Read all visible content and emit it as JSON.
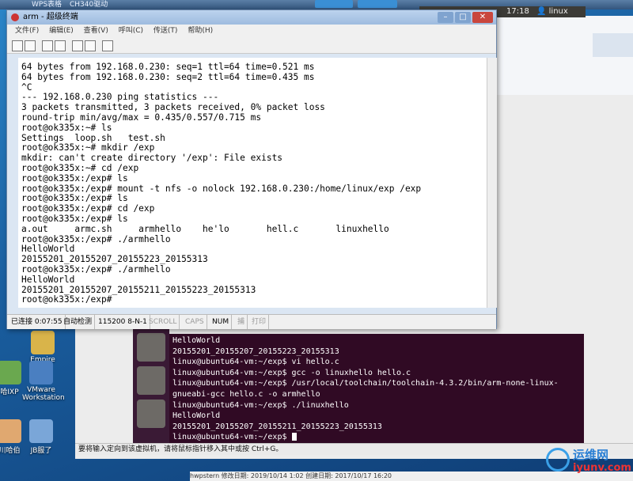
{
  "taskbar_top": {
    "items": [
      "WPS表格",
      "CH340驱动"
    ]
  },
  "desktop_icons": [
    {
      "label": "Empire",
      "icon": "folder-icon"
    },
    {
      "label": "哈IXP",
      "icon": "app-icon"
    },
    {
      "label": "VMware Workstation",
      "icon": "vmware-icon"
    },
    {
      "label": "川哈伯",
      "icon": "user-icon"
    },
    {
      "label": "JB服了",
      "icon": "app-icon"
    }
  ],
  "crt_window": {
    "title": "arm - 超级终端",
    "menu": [
      "文件(F)",
      "编辑(E)",
      "查看(V)",
      "呼叫(C)",
      "传送(T)",
      "帮助(H)"
    ],
    "terminal_lines": [
      "64 bytes from 192.168.0.230: seq=1 ttl=64 time=0.521 ms",
      "64 bytes from 192.168.0.230: seq=2 ttl=64 time=0.435 ms",
      "^C",
      "--- 192.168.0.230 ping statistics ---",
      "3 packets transmitted, 3 packets received, 0% packet loss",
      "round-trip min/avg/max = 0.435/0.557/0.715 ms",
      "root@ok335x:~# ls",
      "Settings  loop.sh   test.sh",
      "root@ok335x:~# mkdir /exp",
      "mkdir: can't create directory '/exp': File exists",
      "root@ok335x:~# cd /exp",
      "root@ok335x:/exp# ls",
      "root@ok335x:/exp# mount -t nfs -o nolock 192.168.0.230:/home/linux/exp /exp",
      "root@ok335x:/exp# ls",
      "root@ok335x:/exp# cd /exp",
      "root@ok335x:/exp# ls",
      "a.out     armc.sh     armhello    he'lo       hell.c       linuxhello",
      "root@ok335x:/exp# ./armhello",
      "HelloWorld",
      "20155201_20155207_20155223_20155313",
      "root@ok335x:/exp# ./armhello",
      "HelloWorld",
      "20155201_20155207_20155211_20155223_20155313",
      "root@ok335x:/exp#"
    ],
    "status": {
      "connection": "已连接 0:07:55",
      "detect": "自动检测",
      "baud": "115200 8-N-1",
      "scroll": "SCROLL",
      "caps": "CAPS",
      "num": "NUM",
      "capture": "捕",
      "print": "打印"
    }
  },
  "ubuntu": {
    "clock": "17:18",
    "user": "linux",
    "terminal_lines": [
      "HelloWorld",
      "20155201_20155207_20155223_20155313",
      "linux@ubuntu64-vm:~/exp$ vi hello.c",
      "linux@ubuntu64-vm:~/exp$ gcc -o linuxhello hello.c",
      "linux@ubuntu64-vm:~/exp$ /usr/local/toolchain/toolchain-4.3.2/bin/arm-none-linux-",
      "gnueabi-gcc hello.c -o armhello",
      "linux@ubuntu64-vm:~/exp$ ./linuxhello",
      "HelloWorld",
      "20155201_20155207_20155211_20155223_20155313",
      "linux@ubuntu64-vm:~/exp$ "
    ]
  },
  "vm_status": "要将输入定向到该虚拟机，请将鼠标指针移入其中或按 Ctrl+G。",
  "bottom_bar": "hwpstern  修改日期: 2019/10/14 1:02   创建日期: 2017/10/17 16:20",
  "watermark": {
    "cn": "运维网",
    "en": "iyunv.com"
  },
  "colors": {
    "crt_title": "#9ebbdf",
    "ubuntu_terminal": "#300a24",
    "launcher": "#3a1a35"
  }
}
